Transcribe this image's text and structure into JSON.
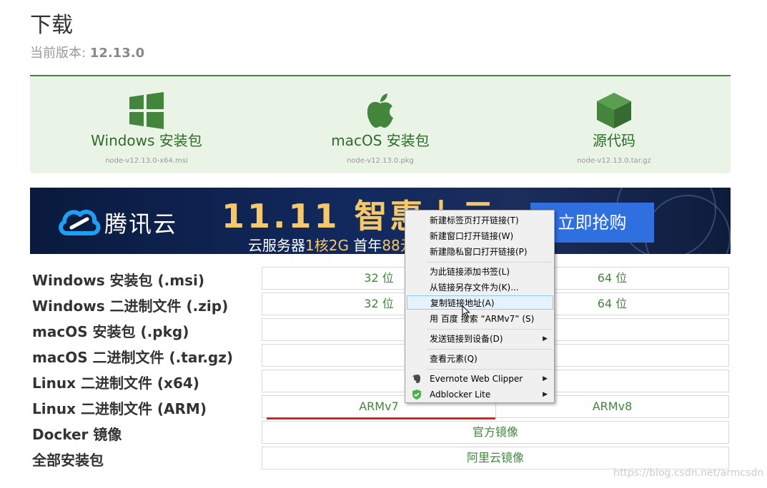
{
  "page": {
    "title": "下载",
    "version_label": "当前版本: ",
    "version": "12.13.0"
  },
  "downloads": [
    {
      "label": "Windows 安装包",
      "file": "node-v12.13.0-x64.msi",
      "icon": "windows-icon"
    },
    {
      "label": "macOS 安装包",
      "file": "node-v12.13.0.pkg",
      "icon": "apple-icon"
    },
    {
      "label": "源代码",
      "file": "node-v12.13.0.tar.gz",
      "icon": "cube-icon"
    }
  ],
  "banner": {
    "brand": "腾讯云",
    "headline": "11.11 智惠上云",
    "sub_prefix": "云服务器",
    "sub_hl1": "1核2G",
    "sub_mid": " 首年",
    "sub_hl2": "88元",
    "cta": "立即抢购"
  },
  "table": {
    "rows": [
      {
        "label": "Windows 安装包 (.msi)",
        "cells": [
          "32 位",
          "64 位"
        ]
      },
      {
        "label": "Windows 二进制文件 (.zip)",
        "cells": [
          "32 位",
          "64 位"
        ]
      },
      {
        "label": "macOS 安装包 (.pkg)",
        "cells": [
          ""
        ]
      },
      {
        "label": "macOS 二进制文件 (.tar.gz)",
        "cells": [
          ""
        ]
      },
      {
        "label": "Linux 二进制文件 (x64)",
        "cells": [
          ""
        ]
      },
      {
        "label": "Linux 二进制文件 (ARM)",
        "cells": [
          "ARMv7",
          "ARMv8"
        ]
      },
      {
        "label": "Docker 镜像",
        "cells": [
          "官方镜像"
        ]
      },
      {
        "label": "全部安装包",
        "cells": [
          "阿里云镜像"
        ]
      }
    ]
  },
  "context_menu": {
    "items": [
      {
        "label": "新建标签页打开链接(T)",
        "arrow": ""
      },
      {
        "label": "新建窗口打开链接(W)",
        "arrow": ""
      },
      {
        "label": "新建隐私窗口打开链接(P)",
        "arrow": ""
      },
      {
        "label": "为此链接添加书签(L)",
        "arrow": ""
      },
      {
        "label": "从链接另存文件为(K)...",
        "arrow": ""
      },
      {
        "label": "复制链接地址(A)",
        "arrow": "",
        "highlighted": true
      },
      {
        "label": "用 百度 搜索 “ARMv7” (S)",
        "arrow": ""
      },
      {
        "label": "发送链接到设备(D)",
        "arrow": "▶"
      },
      {
        "label": "查看元素(Q)",
        "arrow": ""
      },
      {
        "label": "Evernote Web Clipper",
        "arrow": "▶",
        "icon": "evernote-icon"
      },
      {
        "label": "Adblocker Lite",
        "arrow": "▶",
        "icon": "shield-check-icon"
      }
    ]
  },
  "watermark": "https://blog.csdn.net/armcsdn",
  "colors": {
    "accent": "#43853d",
    "download_bg": "#e9f3e6",
    "annotation_red": "#e02020"
  }
}
